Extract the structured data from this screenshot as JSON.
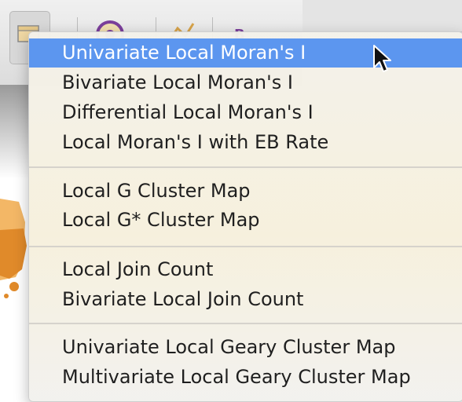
{
  "toolbar": {
    "buttons": [
      {
        "name": "map-layers-icon"
      },
      {
        "name": "target-icon"
      },
      {
        "name": "chart-icon"
      },
      {
        "name": "letter-icon"
      }
    ]
  },
  "menu": {
    "groups": [
      {
        "items": [
          "Univariate Local Moran's I",
          "Bivariate Local Moran's I",
          "Differential Local Moran's I",
          "Local Moran's I with EB Rate"
        ]
      },
      {
        "items": [
          "Local G Cluster Map",
          "Local G* Cluster Map"
        ]
      },
      {
        "items": [
          "Local Join Count",
          "Bivariate Local Join Count"
        ]
      },
      {
        "items": [
          "Univariate Local Geary Cluster Map",
          "Multivariate Local Geary Cluster Map"
        ]
      }
    ],
    "selected": "Univariate Local Moran's I"
  },
  "colors": {
    "selection": "#5c96ef",
    "map_orange": "#e08a2a",
    "map_light": "#f3b766"
  }
}
